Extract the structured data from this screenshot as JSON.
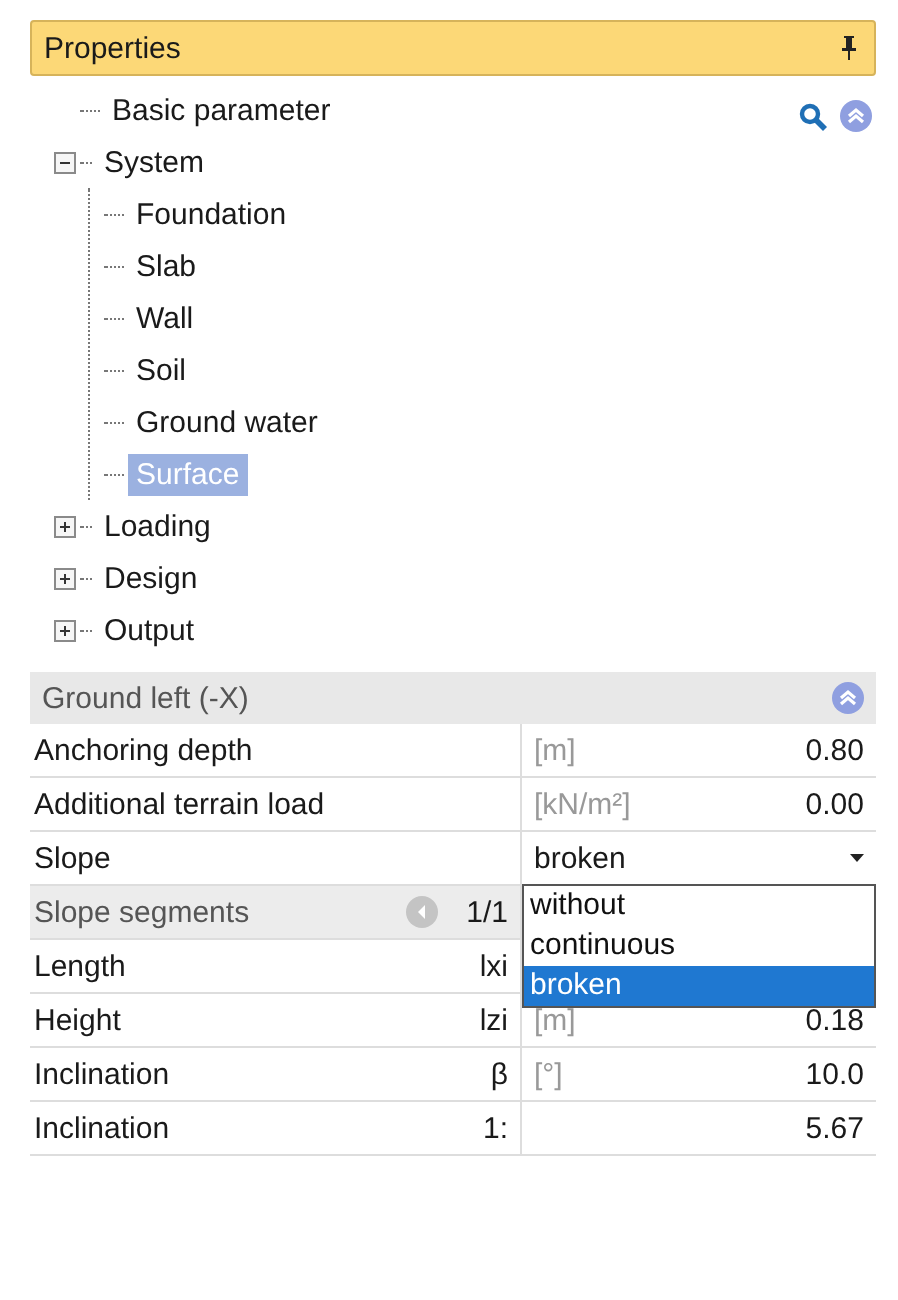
{
  "panel": {
    "title": "Properties"
  },
  "tree": [
    {
      "label": "Basic parameter",
      "selected": false
    },
    {
      "label": "System",
      "expanded": true,
      "selected": false,
      "children": [
        {
          "label": "Foundation",
          "selected": false
        },
        {
          "label": "Slab",
          "selected": false
        },
        {
          "label": "Wall",
          "selected": false
        },
        {
          "label": "Soil",
          "selected": false
        },
        {
          "label": "Ground water",
          "selected": false
        },
        {
          "label": "Surface",
          "selected": true
        }
      ]
    },
    {
      "label": "Loading",
      "expanded": false,
      "selected": false
    },
    {
      "label": "Design",
      "expanded": false,
      "selected": false
    },
    {
      "label": "Output",
      "expanded": false,
      "selected": false
    }
  ],
  "section": {
    "title": "Ground left (-X)"
  },
  "rows": [
    {
      "kind": "value",
      "label": "Anchoring depth",
      "unit": "[m]",
      "value": "0.80"
    },
    {
      "kind": "value",
      "label": "Additional terrain load",
      "unit": "[kN/m²]",
      "value": "0.00"
    },
    {
      "kind": "select",
      "label": "Slope",
      "value": "broken",
      "open": true,
      "options": [
        {
          "label": "without",
          "selected": false
        },
        {
          "label": "continuous",
          "selected": false
        },
        {
          "label": "broken",
          "selected": true
        }
      ]
    },
    {
      "kind": "group",
      "label": "Slope segments",
      "counter": "1/1"
    },
    {
      "kind": "value",
      "label": "Length",
      "symbol": "lxi"
    },
    {
      "kind": "value",
      "label": "Height",
      "symbol": "lzi",
      "unit": "[m]",
      "value": "0.18"
    },
    {
      "kind": "value",
      "label": "Inclination",
      "symbol": "β",
      "unit": "[°]",
      "value": "10.0"
    },
    {
      "kind": "value",
      "label": "Inclination",
      "symbol": "1:",
      "value": "5.67"
    }
  ]
}
